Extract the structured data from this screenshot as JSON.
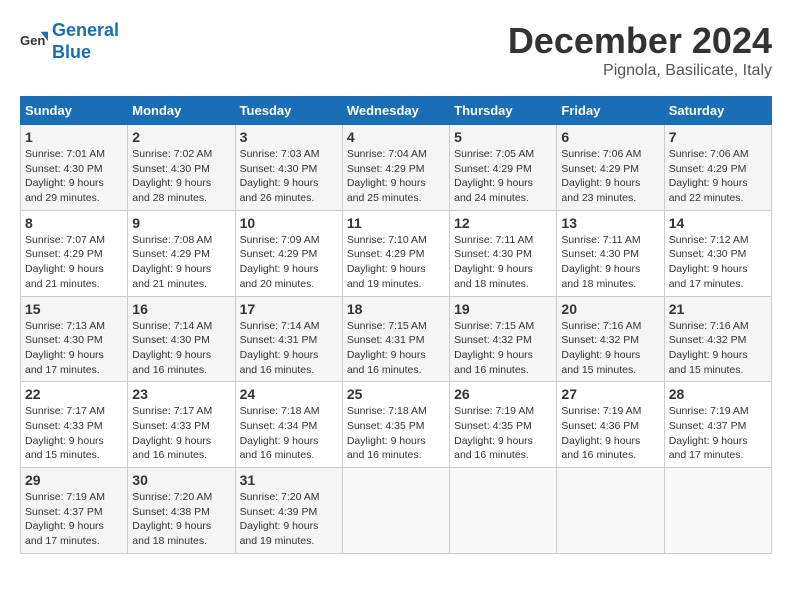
{
  "logo": {
    "line1": "General",
    "line2": "Blue"
  },
  "title": "December 2024",
  "location": "Pignola, Basilicate, Italy",
  "days_of_week": [
    "Sunday",
    "Monday",
    "Tuesday",
    "Wednesday",
    "Thursday",
    "Friday",
    "Saturday"
  ],
  "weeks": [
    [
      {
        "day": 1,
        "info": "Sunrise: 7:01 AM\nSunset: 4:30 PM\nDaylight: 9 hours\nand 29 minutes."
      },
      {
        "day": 2,
        "info": "Sunrise: 7:02 AM\nSunset: 4:30 PM\nDaylight: 9 hours\nand 28 minutes."
      },
      {
        "day": 3,
        "info": "Sunrise: 7:03 AM\nSunset: 4:30 PM\nDaylight: 9 hours\nand 26 minutes."
      },
      {
        "day": 4,
        "info": "Sunrise: 7:04 AM\nSunset: 4:29 PM\nDaylight: 9 hours\nand 25 minutes."
      },
      {
        "day": 5,
        "info": "Sunrise: 7:05 AM\nSunset: 4:29 PM\nDaylight: 9 hours\nand 24 minutes."
      },
      {
        "day": 6,
        "info": "Sunrise: 7:06 AM\nSunset: 4:29 PM\nDaylight: 9 hours\nand 23 minutes."
      },
      {
        "day": 7,
        "info": "Sunrise: 7:06 AM\nSunset: 4:29 PM\nDaylight: 9 hours\nand 22 minutes."
      }
    ],
    [
      {
        "day": 8,
        "info": "Sunrise: 7:07 AM\nSunset: 4:29 PM\nDaylight: 9 hours\nand 21 minutes."
      },
      {
        "day": 9,
        "info": "Sunrise: 7:08 AM\nSunset: 4:29 PM\nDaylight: 9 hours\nand 21 minutes."
      },
      {
        "day": 10,
        "info": "Sunrise: 7:09 AM\nSunset: 4:29 PM\nDaylight: 9 hours\nand 20 minutes."
      },
      {
        "day": 11,
        "info": "Sunrise: 7:10 AM\nSunset: 4:29 PM\nDaylight: 9 hours\nand 19 minutes."
      },
      {
        "day": 12,
        "info": "Sunrise: 7:11 AM\nSunset: 4:30 PM\nDaylight: 9 hours\nand 18 minutes."
      },
      {
        "day": 13,
        "info": "Sunrise: 7:11 AM\nSunset: 4:30 PM\nDaylight: 9 hours\nand 18 minutes."
      },
      {
        "day": 14,
        "info": "Sunrise: 7:12 AM\nSunset: 4:30 PM\nDaylight: 9 hours\nand 17 minutes."
      }
    ],
    [
      {
        "day": 15,
        "info": "Sunrise: 7:13 AM\nSunset: 4:30 PM\nDaylight: 9 hours\nand 17 minutes."
      },
      {
        "day": 16,
        "info": "Sunrise: 7:14 AM\nSunset: 4:30 PM\nDaylight: 9 hours\nand 16 minutes."
      },
      {
        "day": 17,
        "info": "Sunrise: 7:14 AM\nSunset: 4:31 PM\nDaylight: 9 hours\nand 16 minutes."
      },
      {
        "day": 18,
        "info": "Sunrise: 7:15 AM\nSunset: 4:31 PM\nDaylight: 9 hours\nand 16 minutes."
      },
      {
        "day": 19,
        "info": "Sunrise: 7:15 AM\nSunset: 4:32 PM\nDaylight: 9 hours\nand 16 minutes."
      },
      {
        "day": 20,
        "info": "Sunrise: 7:16 AM\nSunset: 4:32 PM\nDaylight: 9 hours\nand 15 minutes."
      },
      {
        "day": 21,
        "info": "Sunrise: 7:16 AM\nSunset: 4:32 PM\nDaylight: 9 hours\nand 15 minutes."
      }
    ],
    [
      {
        "day": 22,
        "info": "Sunrise: 7:17 AM\nSunset: 4:33 PM\nDaylight: 9 hours\nand 15 minutes."
      },
      {
        "day": 23,
        "info": "Sunrise: 7:17 AM\nSunset: 4:33 PM\nDaylight: 9 hours\nand 16 minutes."
      },
      {
        "day": 24,
        "info": "Sunrise: 7:18 AM\nSunset: 4:34 PM\nDaylight: 9 hours\nand 16 minutes."
      },
      {
        "day": 25,
        "info": "Sunrise: 7:18 AM\nSunset: 4:35 PM\nDaylight: 9 hours\nand 16 minutes."
      },
      {
        "day": 26,
        "info": "Sunrise: 7:19 AM\nSunset: 4:35 PM\nDaylight: 9 hours\nand 16 minutes."
      },
      {
        "day": 27,
        "info": "Sunrise: 7:19 AM\nSunset: 4:36 PM\nDaylight: 9 hours\nand 16 minutes."
      },
      {
        "day": 28,
        "info": "Sunrise: 7:19 AM\nSunset: 4:37 PM\nDaylight: 9 hours\nand 17 minutes."
      }
    ],
    [
      {
        "day": 29,
        "info": "Sunrise: 7:19 AM\nSunset: 4:37 PM\nDaylight: 9 hours\nand 17 minutes."
      },
      {
        "day": 30,
        "info": "Sunrise: 7:20 AM\nSunset: 4:38 PM\nDaylight: 9 hours\nand 18 minutes."
      },
      {
        "day": 31,
        "info": "Sunrise: 7:20 AM\nSunset: 4:39 PM\nDaylight: 9 hours\nand 19 minutes."
      },
      null,
      null,
      null,
      null
    ]
  ]
}
